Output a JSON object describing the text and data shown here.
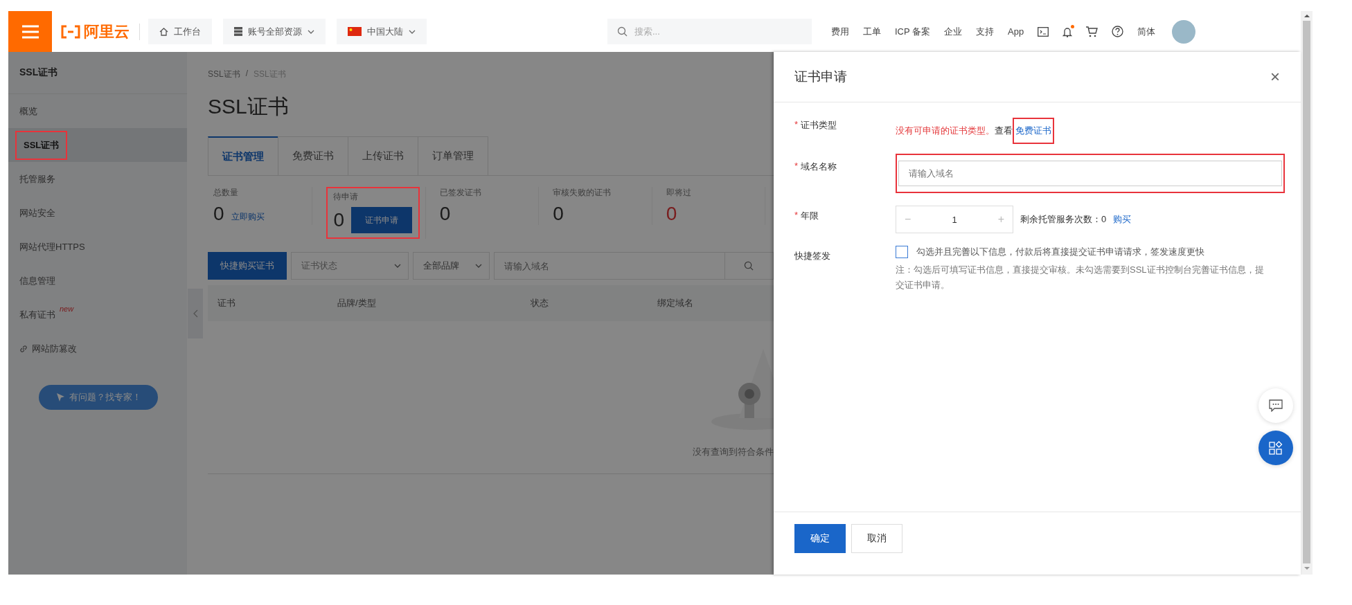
{
  "topbar": {
    "logo": "阿里云",
    "nav_buttons": [
      {
        "label": "工作台",
        "kind": "home"
      },
      {
        "label": "账号全部资源",
        "kind": "resources"
      },
      {
        "label": "中国大陆",
        "kind": "region"
      }
    ],
    "search": {
      "placeholder": "搜索..."
    },
    "links": [
      "费用",
      "工单",
      "ICP 备案",
      "企业",
      "支持",
      "App"
    ],
    "notification_dot": true,
    "language": "简体"
  },
  "sidebar": {
    "title": "SSL证书",
    "items": [
      {
        "label": "概览",
        "selected": false
      },
      {
        "label": "SSL证书",
        "selected": true,
        "highlighted": true
      },
      {
        "label": "托管服务",
        "selected": false
      },
      {
        "label": "网站安全",
        "selected": false
      },
      {
        "label": "网站代理HTTPS",
        "selected": false
      },
      {
        "label": "信息管理",
        "selected": false
      },
      {
        "label": "私有证书",
        "selected": false,
        "badge": "new"
      },
      {
        "label": "网站防篡改",
        "selected": false,
        "kind": "external"
      }
    ],
    "help_button": "有问题？找专家！"
  },
  "main": {
    "breadcrumb": [
      "SSL证书",
      "SSL证书"
    ],
    "breadcrumb_separator": "/",
    "title": "SSL证书",
    "tabs": [
      {
        "label": "证书管理",
        "selected": true
      },
      {
        "label": "免费证书",
        "selected": false
      },
      {
        "label": "上传证书",
        "selected": false
      },
      {
        "label": "订单管理",
        "selected": false
      }
    ],
    "stats": [
      {
        "label": "总数量",
        "value": "0",
        "alert": false,
        "action": {
          "kind": "link",
          "label": "立即购买"
        }
      },
      {
        "label": "待申请",
        "value": "0",
        "alert": false,
        "highlighted": true,
        "action": {
          "kind": "button",
          "label": "证书申请"
        }
      },
      {
        "label": "已签发证书",
        "value": "0",
        "alert": false
      },
      {
        "label": "审核失败的证书",
        "value": "0",
        "alert": false
      },
      {
        "label": "即将过",
        "value": "0",
        "alert": true
      }
    ],
    "toolbar": {
      "buy_button": "快捷购买证书",
      "status_select": "证书状态",
      "brand_select": "全部品牌",
      "search_placeholder": "请输入域名"
    },
    "table": {
      "columns": [
        "证书",
        "品牌/类型",
        "状态",
        "绑定域名"
      ],
      "empty_text": "没有查询到符合条件"
    }
  },
  "drawer": {
    "title": "证书申请",
    "required_mark": "*",
    "fields": [
      {
        "kind": "message",
        "label": "证书类型",
        "required": true,
        "error": "没有可申请的证书类型。",
        "text": "查看",
        "link": "免费证书",
        "highlighted": true
      },
      {
        "kind": "input",
        "label": "域名名称",
        "required": true,
        "placeholder": "请输入域名",
        "highlighted": true
      },
      {
        "kind": "stepper",
        "label": "年限",
        "required": true,
        "value": "1",
        "minus": "−",
        "plus": "+",
        "hint": "剩余托管服务次数：0",
        "link": "购买"
      },
      {
        "kind": "checkbox",
        "label": "快捷签发",
        "required": false,
        "checked": false,
        "text": "勾选并且完善以下信息，付款后将直接提交证书申请请求，签发速度更快",
        "note": "注：勾选后可填写证书信息，直接提交审核。未勾选需要到SSL证书控制台完善证书信息，提交证书申请。"
      }
    ],
    "buttons": [
      {
        "label": "确定",
        "kind": "primary"
      },
      {
        "label": "取消",
        "kind": "default"
      }
    ],
    "close": "×"
  }
}
